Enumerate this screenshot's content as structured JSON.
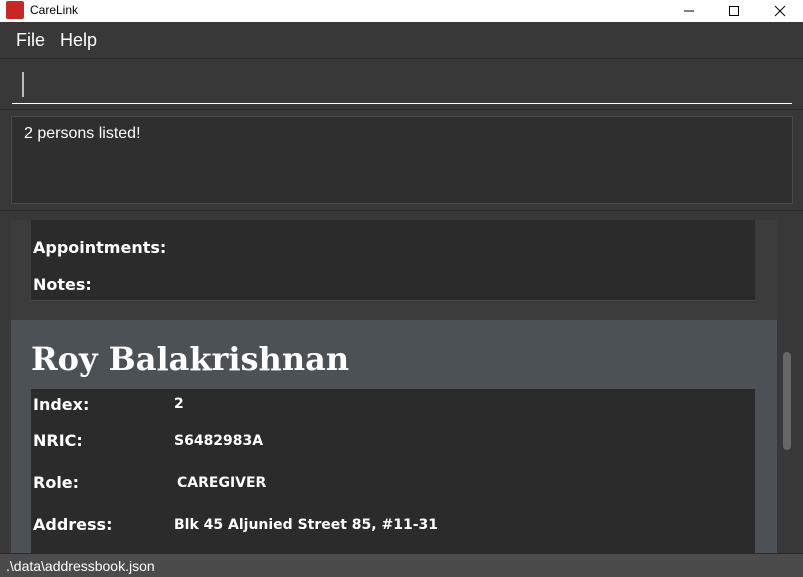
{
  "window": {
    "title": "CareLink",
    "controls": [
      "minimize-icon",
      "maximize-icon",
      "close-icon"
    ],
    "accent": "#c62828"
  },
  "menu": {
    "file": "File",
    "help": "Help"
  },
  "command": {
    "value": "",
    "placeholder": ""
  },
  "result": {
    "message": "2 persons listed!"
  },
  "cards": [
    {
      "selected": false,
      "fields": [
        {
          "label": "Appointments:",
          "value": ""
        },
        {
          "label": "Notes:",
          "value": ""
        }
      ]
    },
    {
      "selected": true,
      "name": "Roy Balakrishnan",
      "fields": [
        {
          "label": "Index:",
          "value": "2"
        },
        {
          "label": "NRIC:",
          "value": "S6482983A"
        },
        {
          "label": "Role:",
          "value": "CAREGIVER"
        },
        {
          "label": "Address:",
          "value": "Blk 45 Aljunied Street 85, #11-31"
        }
      ]
    }
  ],
  "status": {
    "path": ".\\data\\addressbook.json"
  }
}
